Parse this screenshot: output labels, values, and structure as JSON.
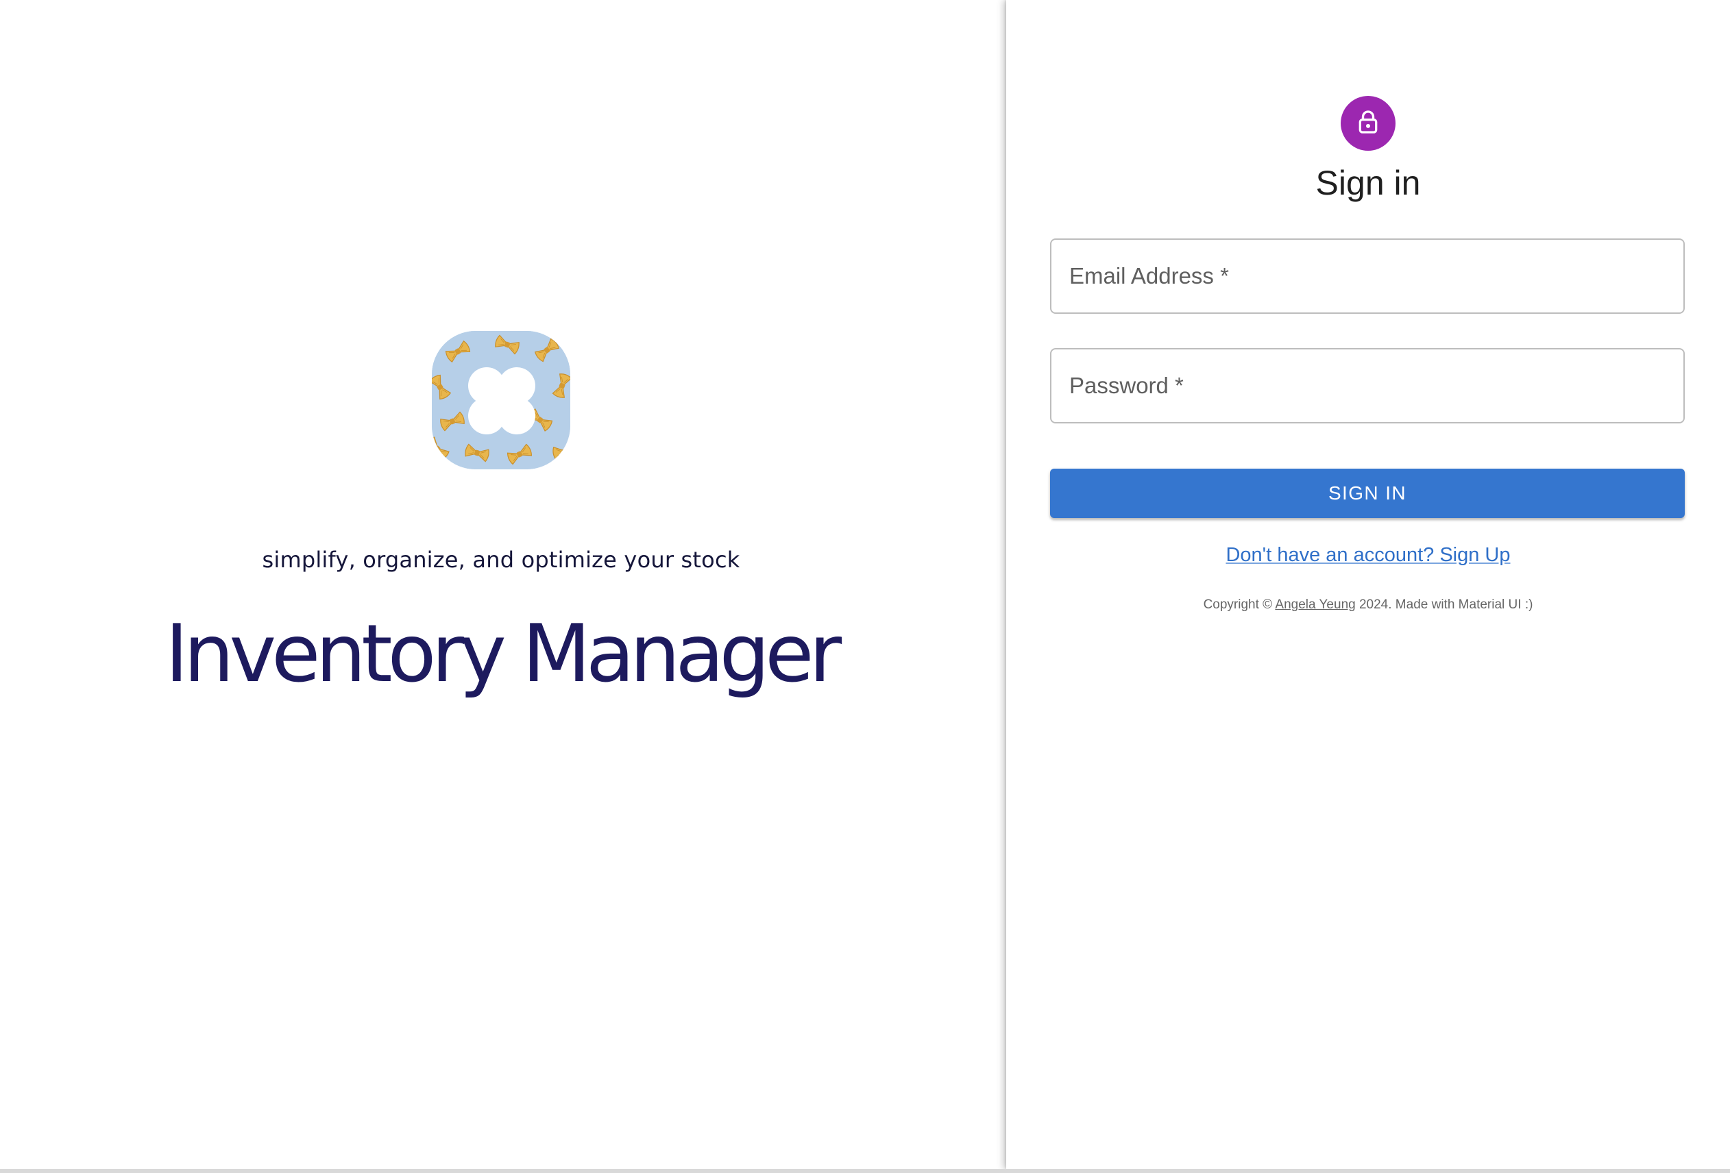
{
  "brand": {
    "tagline": "simplify, organize, and optimize your stock",
    "app_title": "Inventory Manager",
    "logo_icon": "pasta-flower-logo-icon"
  },
  "signin": {
    "avatar_icon": "lock-icon",
    "title": "Sign in",
    "email_label": "Email Address *",
    "email_value": "",
    "password_label": "Password *",
    "password_value": "",
    "button_label": "SIGN IN",
    "signup_link": "Don't have an account? Sign Up",
    "copyright_prefix": "Copyright © ",
    "copyright_author": "Angela Yeung",
    "copyright_suffix": " 2024. Made with Material UI :)"
  },
  "colors": {
    "accent_purple": "#9c27b0",
    "button_blue": "#3576cf",
    "link_blue": "#2f6fc8",
    "title_navy": "#1d1a5e",
    "logo_background": "#b6cfe8"
  }
}
